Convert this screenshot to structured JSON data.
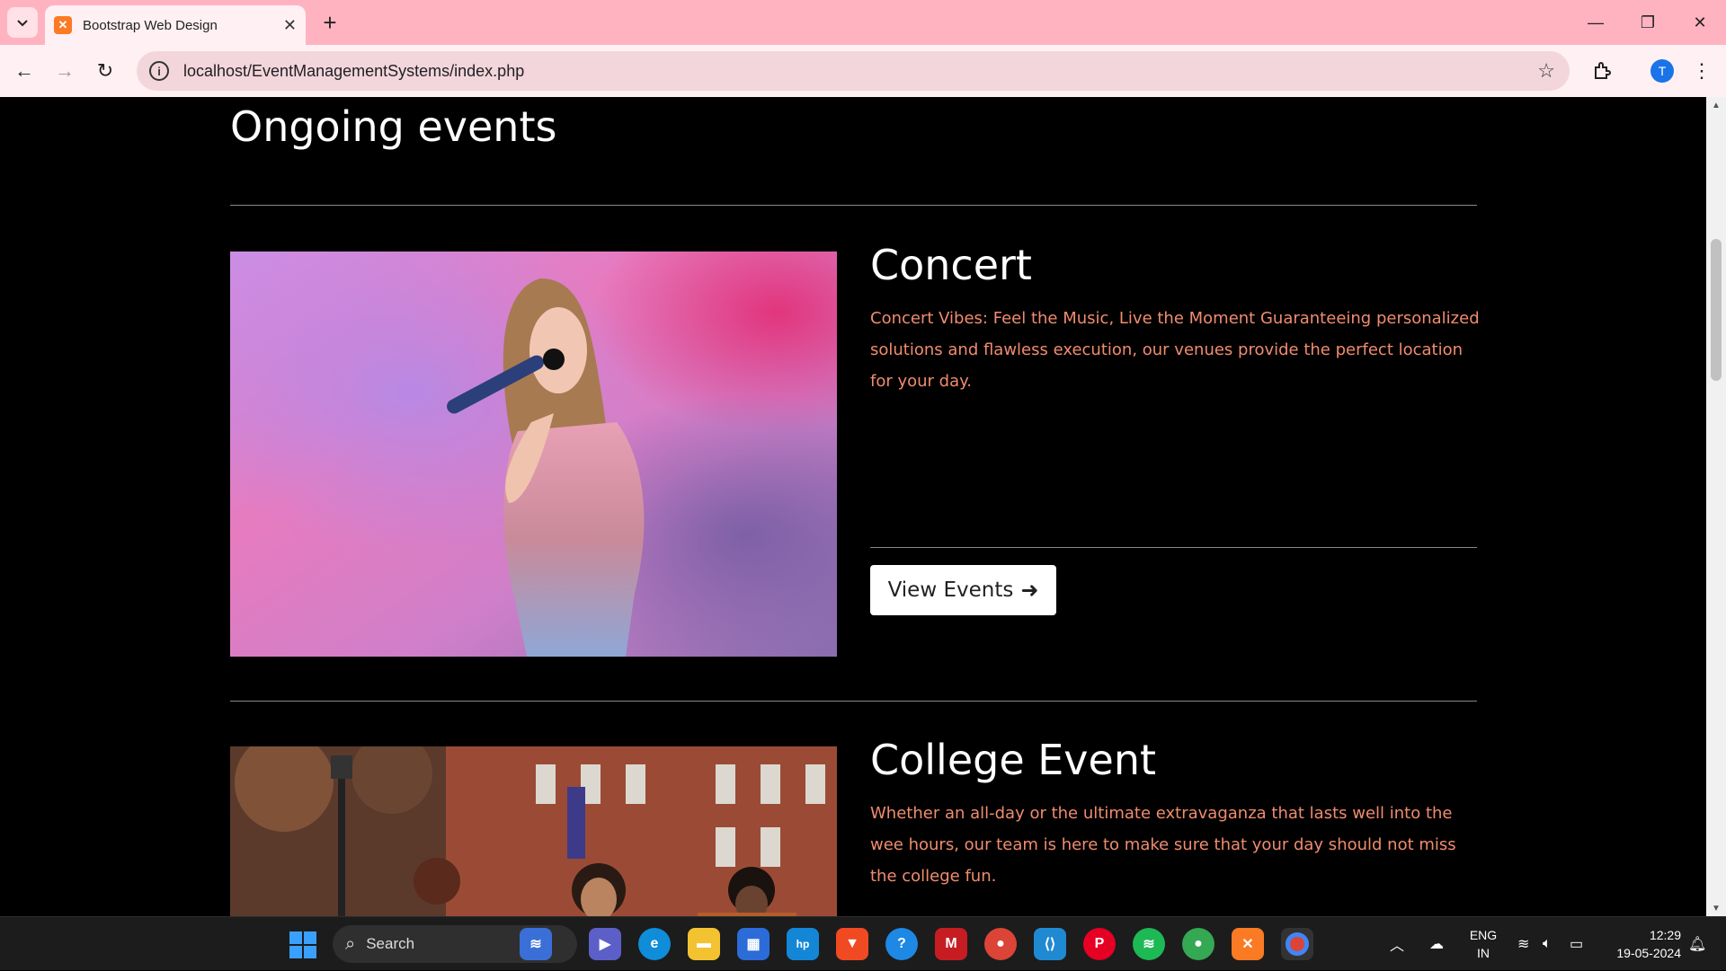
{
  "browser": {
    "tab_title": "Bootstrap Web Design",
    "tab_favicon": "xampp-icon",
    "url": "localhost/EventManagementSystems/index.php",
    "profile_initial": "T"
  },
  "page": {
    "section_title": "Ongoing events",
    "events": [
      {
        "title": "Concert",
        "description": "Concert Vibes: Feel the Music, Live the Moment Guaranteeing personalized solutions and flawless execution, our venues provide the perfect location for your day.",
        "button_label": "View Events"
      },
      {
        "title": "College Event",
        "description": "Whether an all-day or the ultimate extravaganza that lasts well into the wee hours, our team is here to make sure that your day should not miss the college fun."
      }
    ],
    "accent_color": "#f08c6f"
  },
  "taskbar": {
    "search_label": "Search",
    "language": "ENG",
    "region": "IN",
    "time": "12:29",
    "date": "19-05-2024",
    "apps": [
      "widgets-icon",
      "meet-icon",
      "edge-icon",
      "file-explorer-icon",
      "store-icon",
      "myhp-icon",
      "brave-icon",
      "help-icon",
      "mcafee-icon",
      "chrome-icon",
      "vscode-icon",
      "pinterest-icon",
      "spotify-icon",
      "chrome-profile-icon",
      "xampp-icon",
      "chrome-active-icon"
    ]
  }
}
